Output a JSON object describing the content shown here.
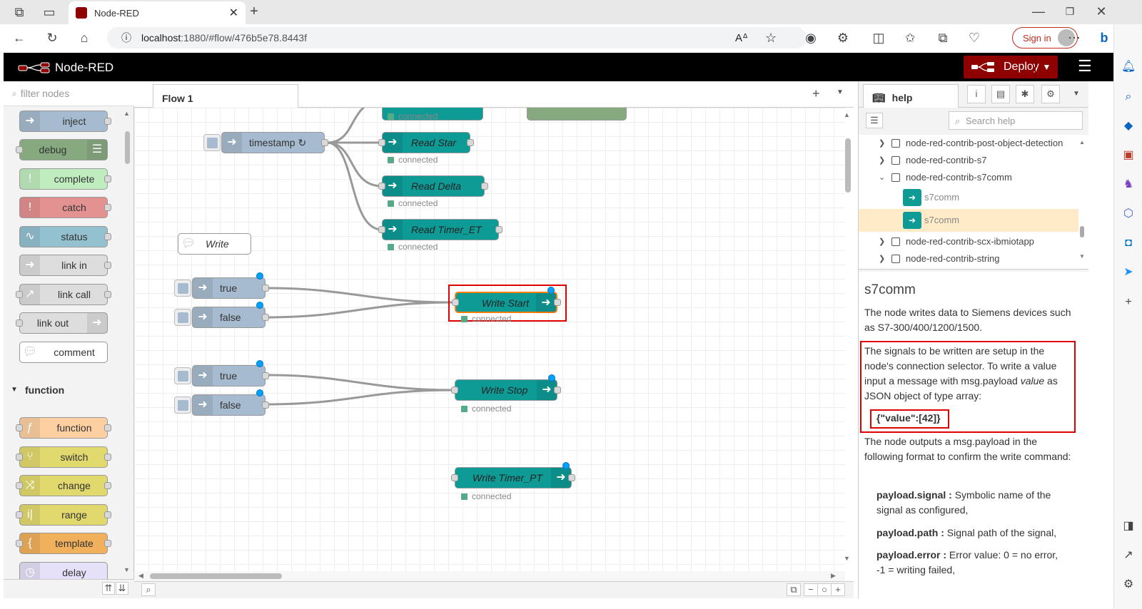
{
  "browser": {
    "tab_title": "Node-RED",
    "url_host": "localhost",
    "url_rest": ":1880/#flow/476b5e78.8443f",
    "signin_label": "Sign in"
  },
  "header": {
    "app_name": "Node-RED",
    "deploy_label": "Deploy"
  },
  "palette": {
    "filter_placeholder": "filter nodes",
    "nodes": [
      {
        "label": "inject",
        "color": "#a6bbcf"
      },
      {
        "label": "debug",
        "color": "#87a980"
      },
      {
        "label": "complete",
        "color": "#c0edc0"
      },
      {
        "label": "catch",
        "color": "#e49191"
      },
      {
        "label": "status",
        "color": "#94c1d0"
      },
      {
        "label": "link in",
        "color": "#dddddd"
      },
      {
        "label": "link call",
        "color": "#dddddd"
      },
      {
        "label": "link out",
        "color": "#dddddd"
      },
      {
        "label": "comment",
        "color": "#ffffff"
      }
    ],
    "category": "function",
    "function_nodes": [
      {
        "label": "function",
        "color": "#fdd0a2"
      },
      {
        "label": "switch",
        "color": "#e2d96e"
      },
      {
        "label": "change",
        "color": "#e2d96e"
      },
      {
        "label": "range",
        "color": "#e2d96e"
      },
      {
        "label": "template",
        "color": "#f0b05c"
      },
      {
        "label": "delay",
        "color": "#e6e0f8"
      }
    ]
  },
  "workspace": {
    "flow_tab": "Flow 1",
    "nodes": {
      "timestamp": "timestamp ↻",
      "read_star": "Read Star",
      "read_delta": "Read Delta",
      "read_timer": "Read Timer_ET",
      "comment": "Write",
      "true1": "true",
      "false1": "false",
      "write_start": "Write Start",
      "true2": "true",
      "false2": "false",
      "write_stop": "Write Stop",
      "write_timer": "Write Timer_PT"
    },
    "status_connected": "connected"
  },
  "sidebar": {
    "tab_label": "help",
    "search_placeholder": "Search help",
    "tree": [
      "node-red-contrib-post-object-detection",
      "node-red-contrib-s7",
      "node-red-contrib-s7comm",
      "s7comm",
      "s7comm",
      "node-red-contrib-scx-ibmiotapp",
      "node-red-contrib-string"
    ],
    "help": {
      "title": "s7comm",
      "p1": "The node writes data to Siemens devices such as S7-300/400/1200/1500.",
      "p2a": "The signals to be written are setup in the node's connection selector. To write a value input a message with msg.payload ",
      "p2b": "value",
      "p2c": " as JSON object of type array:",
      "code": "{\"value\":[42]}",
      "p3": "The node outputs a msg.payload in the following format to confirm the write command:",
      "k1": "payload.signal :",
      "v1": " Symbolic name of the signal as configured,",
      "k2": "payload.path :",
      "v2": " Signal path of the signal,",
      "k3": "payload.error :",
      "v3": " Error value: 0 = no error, -1 = writing failed,"
    }
  }
}
